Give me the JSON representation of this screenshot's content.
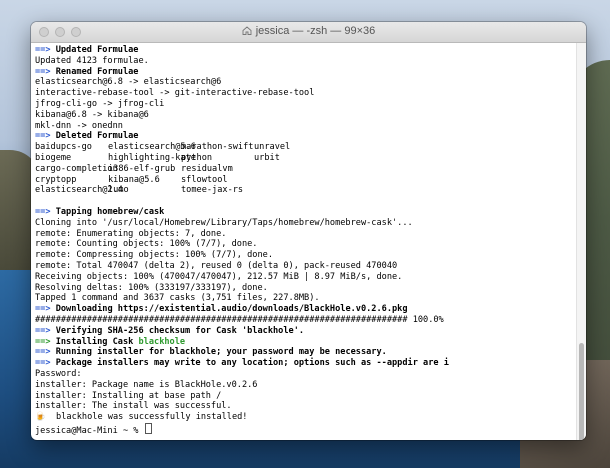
{
  "window": {
    "title": "jessica — -zsh — 99×36"
  },
  "terminal": {
    "arrow": "==>",
    "lines": [
      {
        "kind": "header",
        "text": "Updated Formulae"
      },
      {
        "kind": "plain",
        "text": "Updated 4123 formulae."
      },
      {
        "kind": "header",
        "text": "Renamed Formulae"
      },
      {
        "kind": "plain",
        "text": "elasticsearch@6.8 -> elasticsearch@6"
      },
      {
        "kind": "plain",
        "text": "interactive-rebase-tool -> git-interactive-rebase-tool"
      },
      {
        "kind": "plain",
        "text": "jfrog-cli-go -> jfrog-cli"
      },
      {
        "kind": "plain",
        "text": "kibana@6.8 -> kibana@6"
      },
      {
        "kind": "plain",
        "text": "mkl-dnn -> onednn"
      },
      {
        "kind": "header",
        "text": "Deleted Formulae"
      }
    ],
    "deleted_table": [
      [
        "baidupcs-go",
        "elasticsearch@5.6",
        "marathon-swift",
        "unravel"
      ],
      [
        "biogeme",
        "highlighting-kate",
        "python",
        "urbit"
      ],
      [
        "cargo-completion",
        "i386-elf-grub",
        "residualvm",
        ""
      ],
      [
        "cryptopp",
        "kibana@5.6",
        "sflowtool",
        ""
      ],
      [
        "elasticsearch@2.4",
        "lumo",
        "tomee-jax-rs",
        ""
      ]
    ],
    "lines2": [
      {
        "kind": "blank",
        "text": ""
      },
      {
        "kind": "header",
        "text": "Tapping homebrew/cask"
      },
      {
        "kind": "plain",
        "text": "Cloning into '/usr/local/Homebrew/Library/Taps/homebrew/homebrew-cask'..."
      },
      {
        "kind": "plain",
        "text": "remote: Enumerating objects: 7, done."
      },
      {
        "kind": "plain",
        "text": "remote: Counting objects: 100% (7/7), done."
      },
      {
        "kind": "plain",
        "text": "remote: Compressing objects: 100% (7/7), done."
      },
      {
        "kind": "plain",
        "text": "remote: Total 470047 (delta 2), reused 0 (delta 0), pack-reused 470040"
      },
      {
        "kind": "plain",
        "text": "Receiving objects: 100% (470047/470047), 212.57 MiB | 8.97 MiB/s, done."
      },
      {
        "kind": "plain",
        "text": "Resolving deltas: 100% (333197/333197), done."
      },
      {
        "kind": "plain",
        "text": "Tapped 1 command and 3637 casks (3,751 files, 227.8MB)."
      },
      {
        "kind": "header",
        "text": "Downloading https://existential.audio/downloads/BlackHole.v0.2.6.pkg"
      },
      {
        "kind": "plain",
        "text": "######################################################################## 100.0%"
      },
      {
        "kind": "header",
        "text": "Verifying SHA-256 checksum for Cask 'blackhole'."
      },
      {
        "kind": "install",
        "text": "Installing Cask ",
        "highlight": "blackhole"
      },
      {
        "kind": "header",
        "text": "Running installer for blackhole; your password may be necessary."
      },
      {
        "kind": "header",
        "text": "Package installers may write to any location; options such as --appdir are i"
      },
      {
        "kind": "plain",
        "text": "Password:"
      },
      {
        "kind": "plain",
        "text": "installer: Package name is BlackHole.v0.2.6"
      },
      {
        "kind": "plain",
        "text": "installer: Installing at base path /"
      },
      {
        "kind": "plain",
        "text": "installer: The install was successful."
      },
      {
        "kind": "success",
        "emoji": "🍺",
        "text": "  blackhole was successfully installed!"
      },
      {
        "kind": "prompt",
        "text": "jessica@Mac-Mini ~ % "
      }
    ]
  },
  "colors": {
    "arrow": "#2f5bd1",
    "success_green": "#2f9b2f"
  }
}
